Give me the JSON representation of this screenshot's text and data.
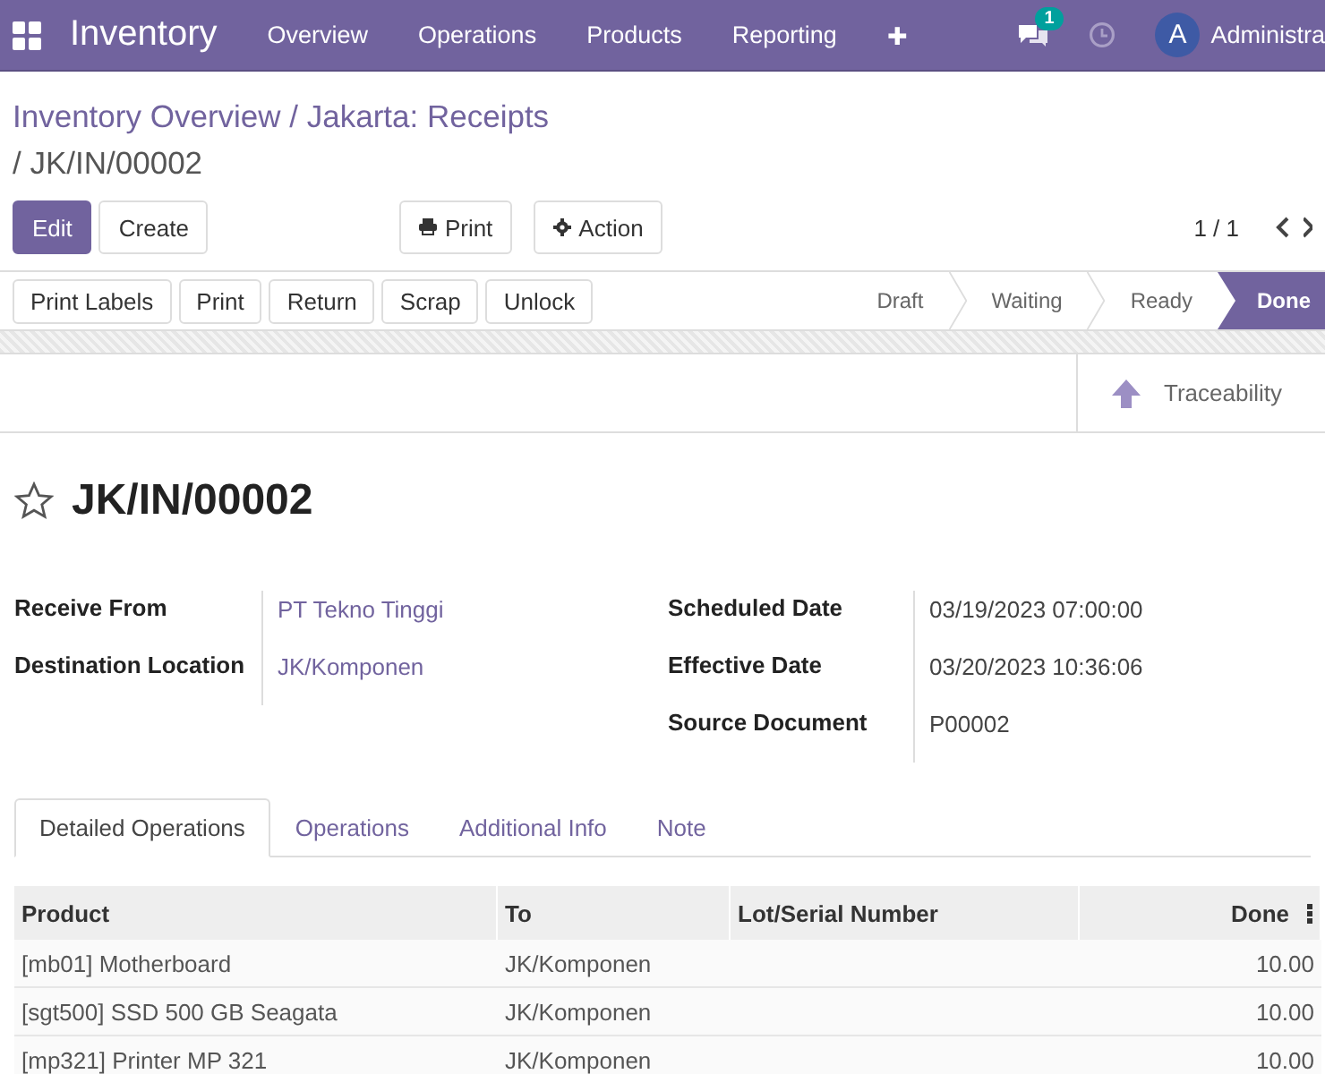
{
  "navbar": {
    "app": "Inventory",
    "menu": [
      "Overview",
      "Operations",
      "Products",
      "Reporting",
      "✚"
    ],
    "messages_badge": "1",
    "avatar": "A",
    "user": "Administra"
  },
  "breadcrumb": {
    "parent": "Inventory Overview / Jakarta: Receipts",
    "current": " / JK/IN/00002"
  },
  "control_buttons": [
    {
      "label": "Edit",
      "kind": "primary"
    },
    {
      "label": "Create",
      "kind": "secondary"
    }
  ],
  "action_buttons": [
    {
      "label": "Print",
      "kind": "print"
    },
    {
      "label": "Action",
      "kind": "gear"
    }
  ],
  "pager": "1 / 1",
  "header_buttons": [
    "Print Labels",
    "Print",
    "Return",
    "Scrap",
    "Unlock"
  ],
  "stages": [
    {
      "label": "Draft",
      "selected": false
    },
    {
      "label": "Waiting",
      "selected": false
    },
    {
      "label": "Ready",
      "selected": false
    },
    {
      "label": "Done",
      "selected": true
    }
  ],
  "smart_button": "Traceability",
  "record": {
    "title": "JK/IN/00002",
    "starred": false
  },
  "fields_left": [
    {
      "label": "Receive From",
      "value": "PT Tekno Tinggi",
      "kind": "link"
    },
    {
      "label": "Destination Location",
      "value": "JK/Komponen",
      "kind": "link"
    }
  ],
  "fields_right": [
    {
      "label": "Scheduled Date",
      "value": "03/19/2023 07:00:00",
      "kind": "text"
    },
    {
      "label": "Effective Date",
      "value": "03/20/2023 10:36:06",
      "kind": "text"
    },
    {
      "label": "Source Document",
      "value": "P00002",
      "kind": "text"
    }
  ],
  "tabs": [
    {
      "label": "Detailed Operations",
      "selected": true
    },
    {
      "label": "Operations",
      "selected": false
    },
    {
      "label": "Additional Info",
      "selected": false
    },
    {
      "label": "Note",
      "selected": false
    }
  ],
  "table": {
    "columns": [
      "Product",
      "To",
      "Lot/Serial Number",
      "Done"
    ],
    "rows": [
      [
        "[mb01] Motherboard",
        "JK/Komponen",
        "",
        "10.00"
      ],
      [
        "[sgt500] SSD 500 GB Seagata",
        "JK/Komponen",
        "",
        "10.00"
      ],
      [
        "[mp321] Printer MP 321",
        "JK/Komponen",
        "",
        "10.00"
      ]
    ]
  }
}
